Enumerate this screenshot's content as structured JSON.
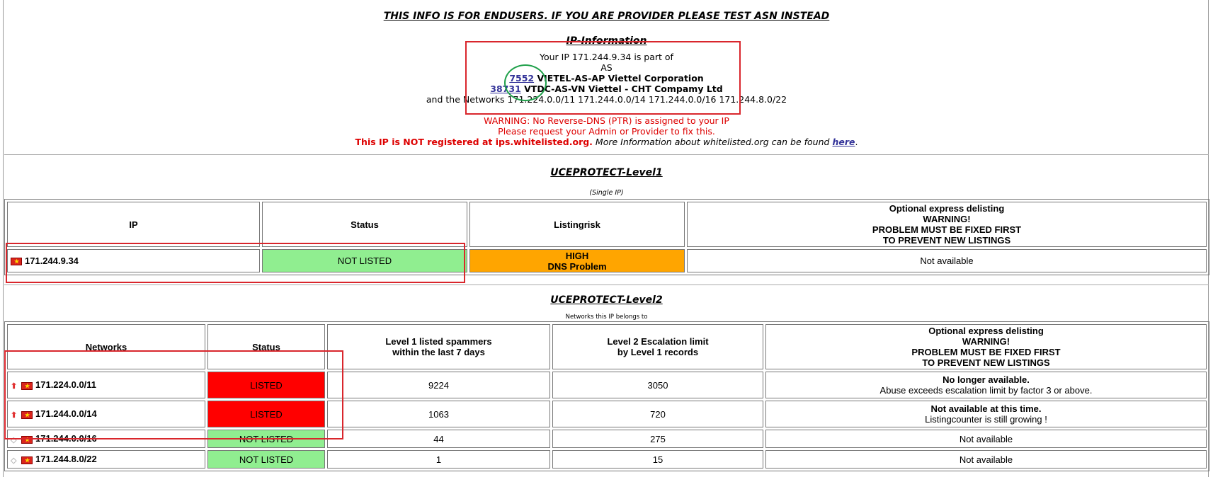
{
  "notice": "THIS INFO IS FOR ENDUSERS. IF YOU ARE PROVIDER PLEASE TEST ASN INSTEAD",
  "ip_info": {
    "title": "IP-Information",
    "line1": "Your IP 171.244.9.34 is part of",
    "line2": "AS",
    "as1_number": "7552",
    "as1_name": " VIETEL-AS-AP Viettel Corporation",
    "as2_number": "38731",
    "as2_name": " VTDC-AS-VN Viettel - CHT Compamy Ltd",
    "networks_line": "and the Networks 171.224.0.0/11 171.244.0.0/14 171.244.0.0/16 171.244.8.0/22",
    "warning1": "WARNING: No Reverse-DNS (PTR) is assigned to your IP",
    "warning2": "Please request your Admin or Provider to fix this.",
    "not_registered": "This IP is NOT registered at ips.whitelisted.org.",
    "more_info": " More Information about whitelisted.org can be found ",
    "here_link": "here",
    "period": "."
  },
  "level1": {
    "title": "UCEPROTECT-Level1",
    "subtitle": "(Single IP)",
    "headers": {
      "ip": "IP",
      "status": "Status",
      "risk": "Listingrisk",
      "opt1": "Optional express delisting",
      "opt2": "WARNING!",
      "opt3": "PROBLEM MUST BE FIXED FIRST",
      "opt4": "TO PREVENT NEW LISTINGS"
    },
    "row": {
      "ip": "171.244.9.34",
      "status": "NOT LISTED",
      "risk1": "HIGH",
      "risk2": "DNS Problem",
      "delisting": "Not available"
    }
  },
  "level2": {
    "title": "UCEPROTECT-Level2",
    "subtitle": "Networks this IP belongs to",
    "headers": {
      "networks": "Networks",
      "status": "Status",
      "l1a": "Level 1 listed spammers",
      "l1b": "within the last 7 days",
      "l2a": "Level 2 Escalation limit",
      "l2b": "by Level 1 records",
      "opt1": "Optional express delisting",
      "opt2": "WARNING!",
      "opt3": "PROBLEM MUST BE FIXED FIRST",
      "opt4": "TO PREVENT NEW LISTINGS"
    },
    "rows": [
      {
        "network": "171.224.0.0/11",
        "status": "LISTED",
        "spammers": "9224",
        "limit": "3050",
        "del1": "No longer available.",
        "del2": "Abuse exceeds escalation limit by factor 3 or above."
      },
      {
        "network": "171.244.0.0/14",
        "status": "LISTED",
        "spammers": "1063",
        "limit": "720",
        "del1": "Not available at this time.",
        "del2": "Listingcounter is still growing !"
      },
      {
        "network": "171.244.0.0/16",
        "status": "NOT LISTED",
        "spammers": "44",
        "limit": "275",
        "del1": "Not available"
      },
      {
        "network": "171.244.8.0/22",
        "status": "NOT LISTED",
        "spammers": "1",
        "limit": "15",
        "del1": "Not available"
      }
    ]
  },
  "colors": {
    "listed": "#ff0000",
    "not_listed": "#90ee90",
    "risk_high": "#ffa500",
    "annotation_rect": "#d9262c",
    "annotation_circle": "#1fa04a",
    "link": "#333399"
  },
  "icons": {
    "flag": "vietnam-flag-icon",
    "listed_arrow": "red-up-arrow-icon",
    "unlisted_arrow": "gray-diamond-icon"
  }
}
